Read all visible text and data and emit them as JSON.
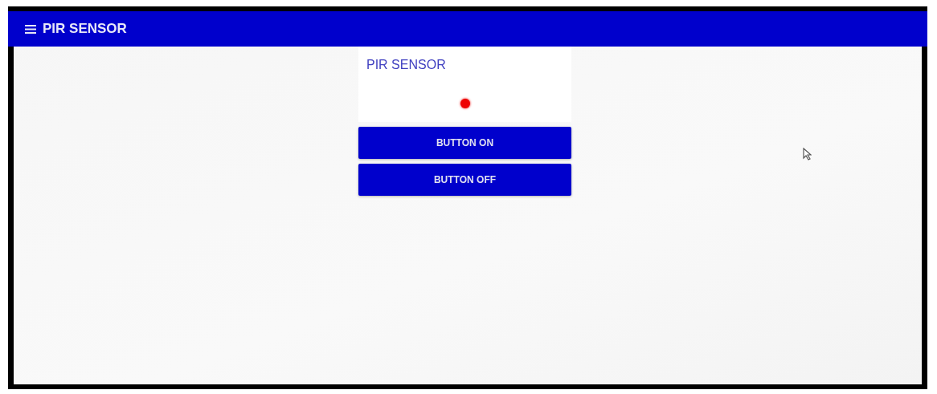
{
  "app_bar": {
    "title": "PIR SENSOR"
  },
  "card": {
    "title": "PIR SENSOR",
    "indicator": {
      "on": true
    }
  },
  "buttons": [
    {
      "label": "BUTTON ON"
    },
    {
      "label": "BUTTON OFF"
    }
  ]
}
